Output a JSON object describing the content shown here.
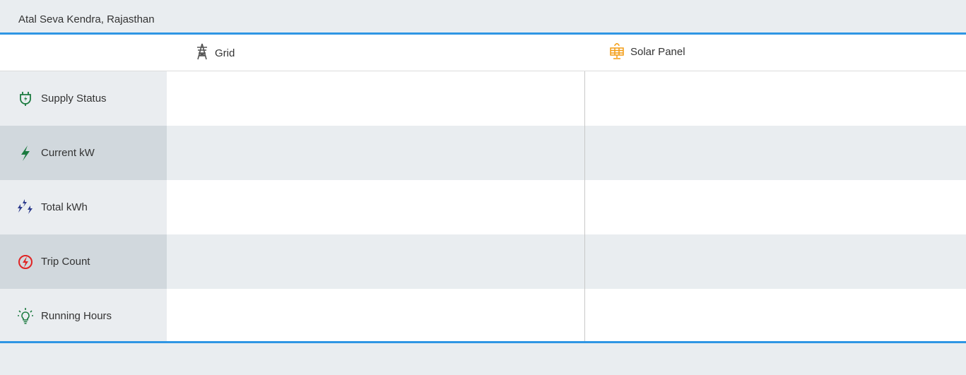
{
  "header": {
    "title": "Atal Seva Kendra, Rajasthan"
  },
  "columns": [
    {
      "label": "Grid",
      "icon": "power-tower-icon",
      "icon_color": "#555555"
    },
    {
      "label": "Solar Panel",
      "icon": "solar-panel-icon",
      "icon_color": "#f39c12"
    }
  ],
  "rows": [
    {
      "label": "Supply Status",
      "icon": "plug-power-icon",
      "icon_color": "#1b7a3f"
    },
    {
      "label": "Current kW",
      "icon": "lightning-bolt-icon",
      "icon_color": "#1b7a3f"
    },
    {
      "label": "Total kWh",
      "icon": "multiple-bolts-icon",
      "icon_color": "#2c3a8c"
    },
    {
      "label": "Trip Count",
      "icon": "bolt-circle-icon",
      "icon_color": "#e02424"
    },
    {
      "label": "Running Hours",
      "icon": "lightbulb-icon",
      "icon_color": "#1b7a3f"
    }
  ],
  "colors": {
    "accent": "#2f96e4",
    "background": "#e9edf0"
  }
}
